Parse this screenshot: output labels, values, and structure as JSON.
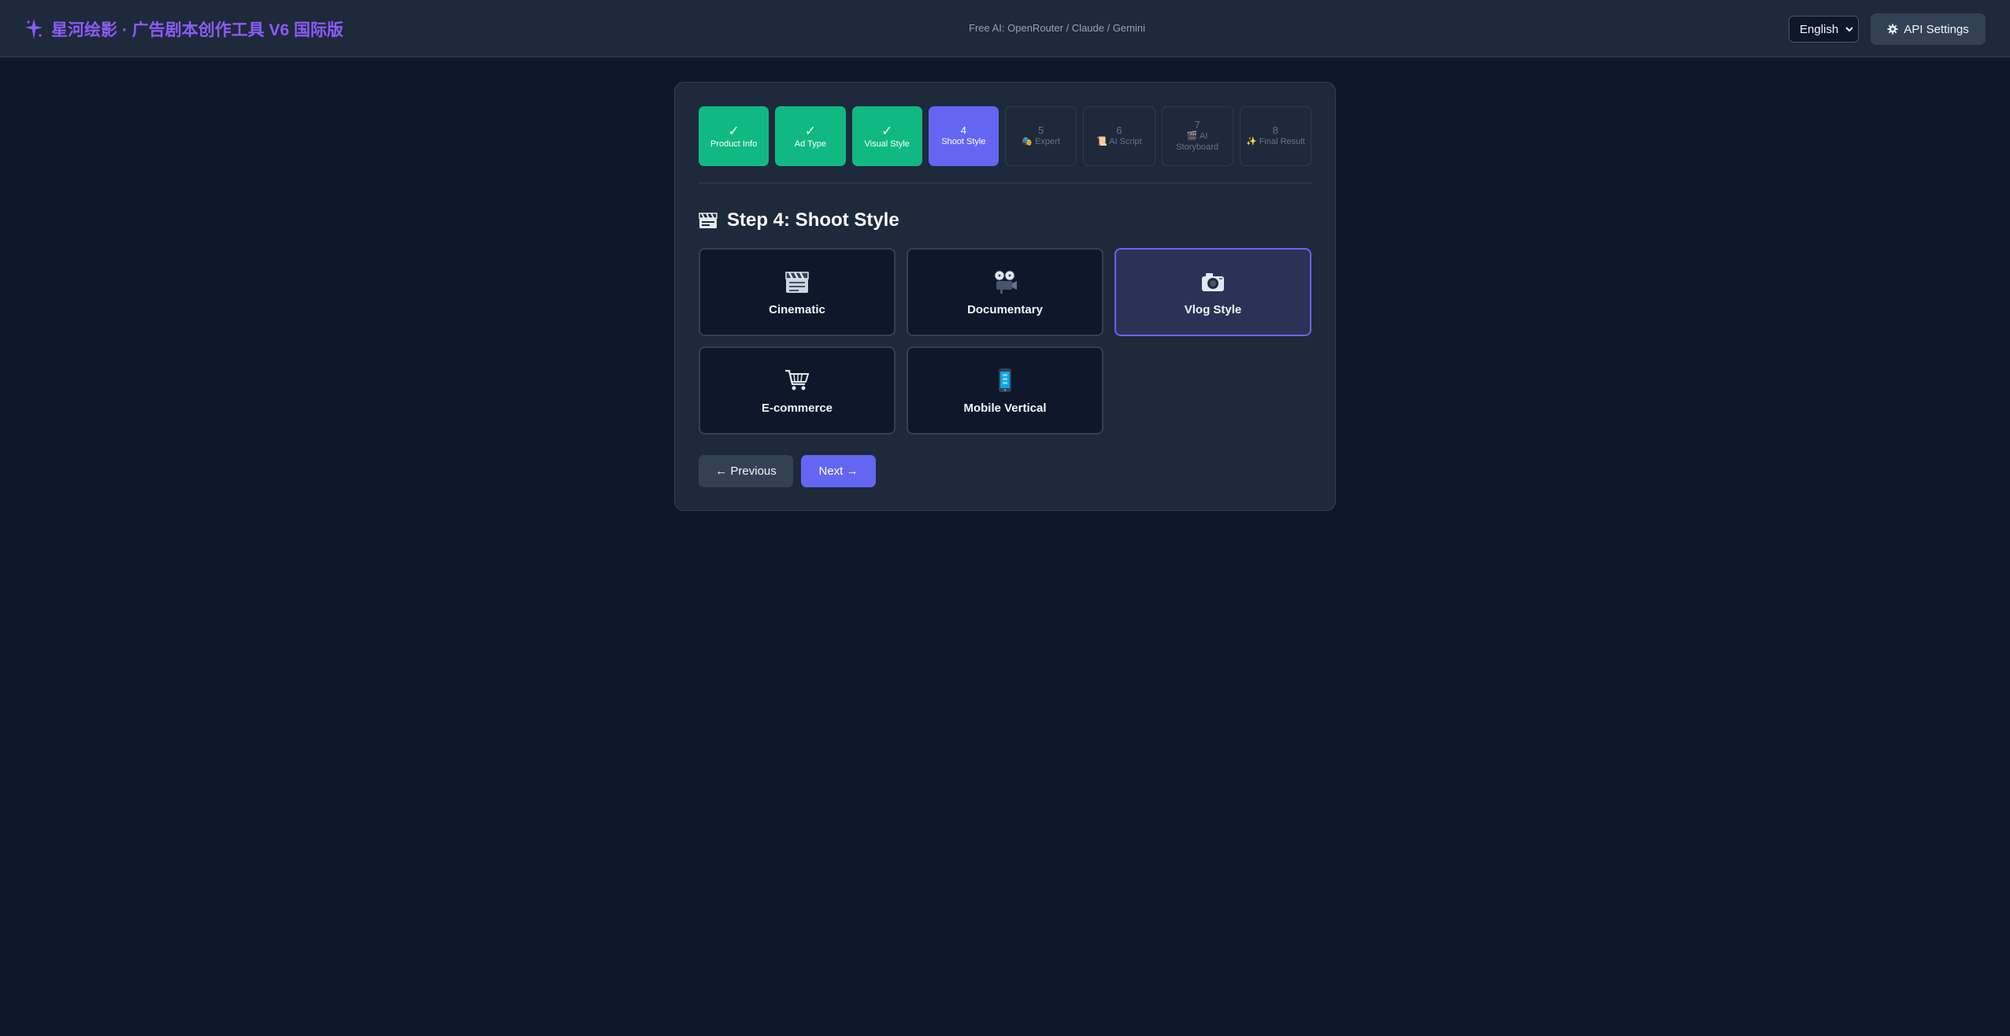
{
  "header": {
    "title": "星河绘影 · 广告剧本创作工具 V6 国际版",
    "logo_icon": "sparkle-star-icon",
    "subtitle": "Free AI: OpenRouter / Claude / Gemini",
    "language": {
      "selected": "English"
    },
    "api_settings_label": "API Settings",
    "api_settings_icon": "gear-icon"
  },
  "steps": [
    {
      "num": "✓",
      "label": "Product Info",
      "state": "done"
    },
    {
      "num": "✓",
      "label": "Ad Type",
      "state": "done"
    },
    {
      "num": "✓",
      "label": "Visual Style",
      "state": "done"
    },
    {
      "num": "4",
      "label": "Shoot Style",
      "state": "active"
    },
    {
      "num": "5",
      "label": "🎭 Expert",
      "state": "todo"
    },
    {
      "num": "6",
      "label": "📜 AI Script",
      "state": "todo"
    },
    {
      "num": "7",
      "label": "🎬 AI Storyboard",
      "state": "todo"
    },
    {
      "num": "8",
      "label": "✨ Final Result",
      "state": "todo"
    }
  ],
  "main": {
    "title": "Step 4: Shoot Style",
    "title_icon": "clapperboard-icon",
    "options": [
      {
        "label": "Cinematic",
        "icon": "clapperboard-icon",
        "selected": false
      },
      {
        "label": "Documentary",
        "icon": "film-projector-icon",
        "selected": false
      },
      {
        "label": "Vlog Style",
        "icon": "camera-icon",
        "selected": true
      },
      {
        "label": "E-commerce",
        "icon": "shopping-cart-icon",
        "selected": false
      },
      {
        "label": "Mobile Vertical",
        "icon": "mobile-phone-icon",
        "selected": false
      }
    ],
    "prev_label": "← Previous",
    "next_label": "Next →"
  },
  "colors": {
    "accent": "#6366f1",
    "done": "#10b981",
    "brand": "#8b5cf6",
    "background": "#0f172a",
    "panel": "#1e293b"
  }
}
